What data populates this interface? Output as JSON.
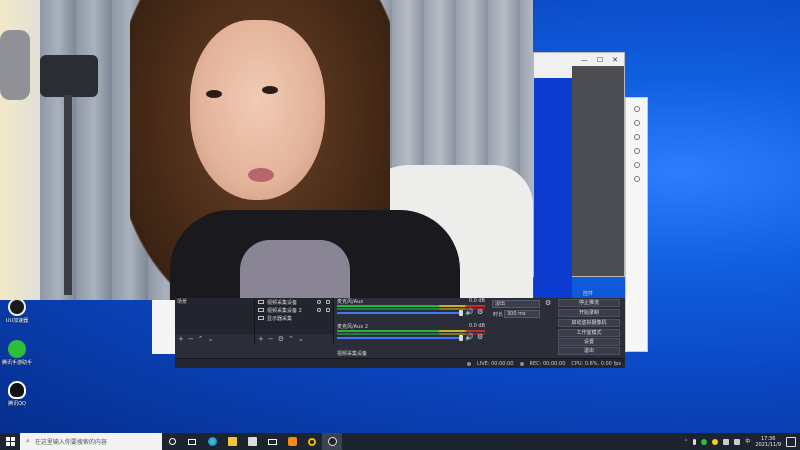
{
  "desktop": {
    "icons": [
      {
        "label": "UU加速器",
        "color": "#1a1a1a"
      },
      {
        "label": "腾讯手游助手",
        "color": "#2dbf3a"
      },
      {
        "label": "腾讯QQ",
        "color": "#ffffff"
      }
    ]
  },
  "window_back": {
    "minimize": "—",
    "maximize": "☐",
    "close": "✕"
  },
  "obs": {
    "scenes_header": "场景",
    "sources": [
      {
        "name": "视频采集设备"
      },
      {
        "name": "视频采集设备 2"
      },
      {
        "name": "显示器采集"
      }
    ],
    "mixer": [
      {
        "name": "麦克风/Aux",
        "level": "0.0 dB"
      },
      {
        "name": "麦克风/Aux 2",
        "level": "0.0 dB"
      }
    ],
    "mixer_extra": "视频采集设备",
    "transition": {
      "type": "淡出",
      "duration_label": "时长",
      "duration": "300 ms"
    },
    "controls_header": "控件",
    "controls": [
      "停止推流",
      "开始录制",
      "启动虚拟摄像机",
      "工作室模式",
      "设置",
      "退出"
    ],
    "status": {
      "live": "LIVE: 00:00:00",
      "rec": "REC: 00:00:00",
      "cpu": "CPU: 0.6%, 0.00 fps"
    }
  },
  "taskbar": {
    "search_placeholder": "在这里输入你要搜索的内容",
    "time": "17:36",
    "date": "2021/11/9",
    "lang": "中"
  }
}
